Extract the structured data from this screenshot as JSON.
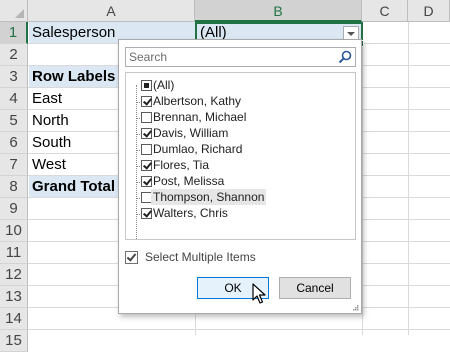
{
  "sheet": {
    "columns": [
      "A",
      "B",
      "C",
      "D"
    ],
    "selected_column": "B",
    "rows": [
      "1",
      "2",
      "3",
      "4",
      "5",
      "6",
      "7",
      "8",
      "9",
      "10",
      "11",
      "12",
      "13",
      "14",
      "15"
    ],
    "selected_row": "1",
    "cells": {
      "a1": "Salesperson",
      "b1": "(All)",
      "a3": "Row Labels",
      "a4": "East",
      "a5": "North",
      "a6": "South",
      "a7": "West",
      "a8": "Grand Total"
    }
  },
  "filter_popup": {
    "search_placeholder": "Search",
    "items": [
      {
        "label": "(All)",
        "state": "partial"
      },
      {
        "label": "Albertson, Kathy",
        "state": "checked"
      },
      {
        "label": "Brennan, Michael",
        "state": "unchecked"
      },
      {
        "label": "Davis, William",
        "state": "checked"
      },
      {
        "label": "Dumlao, Richard",
        "state": "unchecked"
      },
      {
        "label": "Flores, Tia",
        "state": "checked"
      },
      {
        "label": "Post, Melissa",
        "state": "checked"
      },
      {
        "label": "Thompson, Shannon",
        "state": "unchecked"
      },
      {
        "label": "Walters, Chris",
        "state": "checked"
      }
    ],
    "select_multiple_label": "Select Multiple Items",
    "select_multiple_checked": true,
    "ok_label": "OK",
    "cancel_label": "Cancel"
  },
  "colors": {
    "accent": "#217346",
    "selection_fill": "#dbe8f4",
    "primary_button_border": "#0078d7"
  }
}
